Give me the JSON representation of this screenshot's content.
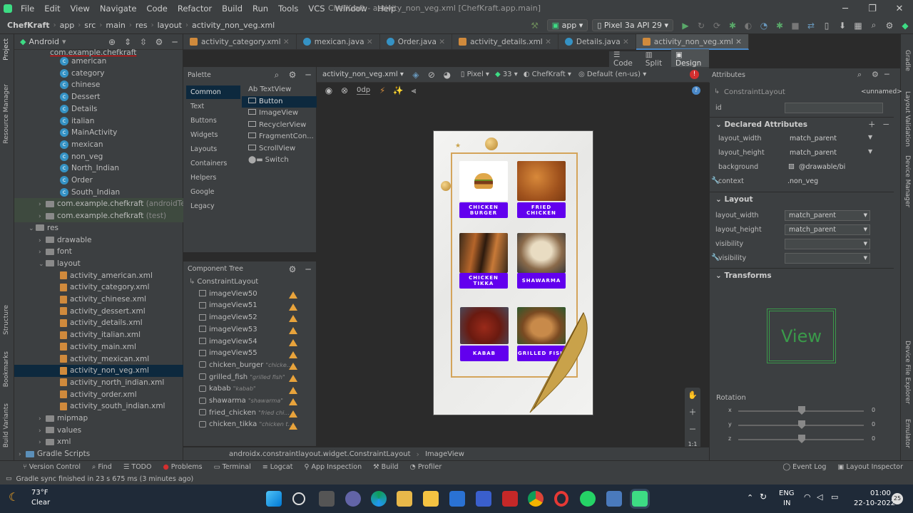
{
  "menu": {
    "items": [
      "File",
      "Edit",
      "View",
      "Navigate",
      "Code",
      "Refactor",
      "Build",
      "Run",
      "Tools",
      "VCS",
      "Window",
      "Help"
    ],
    "title": "ChefKraft - activity_non_veg.xml [ChefKraft.app.main]"
  },
  "nav": {
    "crumbs": [
      "ChefKraft",
      "app",
      "src",
      "main",
      "res",
      "layout",
      "activity_non_veg.xml"
    ],
    "run_config": "app",
    "device": "Pixel 3a API 29"
  },
  "project": {
    "view": "Android",
    "pkg_partial": "com.example.chefkraft",
    "classes": [
      "american",
      "category",
      "chinese",
      "Dessert",
      "Details",
      "italian",
      "MainActivity",
      "mexican",
      "non_veg",
      "North_Indian",
      "Order",
      "South_Indian"
    ],
    "pkg_android_test": "com.example.chefkraft",
    "pkg_android_test_note": "(androidTest)",
    "pkg_test": "com.example.chefkraft",
    "pkg_test_note": "(test)",
    "res": "res",
    "drawable": "drawable",
    "font": "font",
    "layout": "layout",
    "layouts": [
      "activity_american.xml",
      "activity_category.xml",
      "activity_chinese.xml",
      "activity_dessert.xml",
      "activity_details.xml",
      "activity_italian.xml",
      "activity_main.xml",
      "activity_mexican.xml",
      "activity_non_veg.xml",
      "activity_north_indian.xml",
      "activity_order.xml",
      "activity_south_indian.xml"
    ],
    "mipmap": "mipmap",
    "values": "values",
    "xml": "xml",
    "gradle": "Gradle Scripts"
  },
  "left_strip": [
    "Project",
    "Resource Manager",
    "Structure",
    "Bookmarks",
    "Build Variants"
  ],
  "right_strip": [
    "Gradle",
    "Layout Validation",
    "Device Manager",
    "Device File Explorer",
    "Emulator"
  ],
  "tabs": [
    "activity_category.xml",
    "mexican.java",
    "Order.java",
    "activity_details.xml",
    "Details.java",
    "activity_non_veg.xml"
  ],
  "view_modes": [
    "Code",
    "Split",
    "Design"
  ],
  "palette": {
    "title": "Palette",
    "categories": [
      "Common",
      "Text",
      "Buttons",
      "Widgets",
      "Layouts",
      "Containers",
      "Helpers",
      "Google",
      "Legacy"
    ],
    "items": [
      "Ab TextView",
      "Button",
      "ImageView",
      "RecyclerView",
      "FragmentCon...",
      "ScrollView",
      "Switch"
    ]
  },
  "design_toolbar": {
    "file": "activity_non_veg.xml",
    "device": "Pixel",
    "api": "33",
    "theme": "ChefKraft",
    "locale": "Default (en-us)",
    "margin": "0dp"
  },
  "component_tree": {
    "title": "Component Tree",
    "root": "ConstraintLayout",
    "items": [
      {
        "name": "imageView50",
        "hint": ""
      },
      {
        "name": "imageView51",
        "hint": ""
      },
      {
        "name": "imageView52",
        "hint": ""
      },
      {
        "name": "imageView53",
        "hint": ""
      },
      {
        "name": "imageView54",
        "hint": ""
      },
      {
        "name": "imageView55",
        "hint": ""
      },
      {
        "name": "chicken_burger",
        "hint": "\"chicke..."
      },
      {
        "name": "grilled_fish",
        "hint": "\"grilled fish\""
      },
      {
        "name": "kabab",
        "hint": "\"kabab\""
      },
      {
        "name": "shawarma",
        "hint": "\"shawarma\""
      },
      {
        "name": "fried_chicken",
        "hint": "\"fried chi..."
      },
      {
        "name": "chicken_tikka",
        "hint": "\"chicken t..."
      }
    ]
  },
  "phone": {
    "cards": [
      "CHICKEN BURGER",
      "FRIED CHICKEN",
      "CHICKEN TIKKA",
      "SHAWARMA",
      "KABAB",
      "GRILLED FISH"
    ]
  },
  "attributes": {
    "title": "Attributes",
    "component": "ConstraintLayout",
    "unnamed": "<unnamed>",
    "id_label": "id",
    "declared": "Declared Attributes",
    "decl_rows": [
      {
        "k": "layout_width",
        "v": "match_parent"
      },
      {
        "k": "layout_height",
        "v": "match_parent"
      },
      {
        "k": "background",
        "v": "@drawable/bi"
      },
      {
        "k": "context",
        "v": ".non_veg"
      }
    ],
    "layout": "Layout",
    "layout_rows": [
      {
        "k": "layout_width",
        "v": "match_parent"
      },
      {
        "k": "layout_height",
        "v": "match_parent"
      },
      {
        "k": "visibility",
        "v": ""
      },
      {
        "k": "visibility",
        "v": ""
      }
    ],
    "transforms": "Transforms",
    "view_label": "View",
    "rotation": "Rotation",
    "rot": [
      {
        "k": "x",
        "v": "0"
      },
      {
        "k": "y",
        "v": "0"
      },
      {
        "k": "z",
        "v": "0"
      }
    ]
  },
  "path_bar": [
    "androidx.constraintlayout.widget.ConstraintLayout",
    "ImageView"
  ],
  "bottom_tools": [
    "Version Control",
    "Find",
    "TODO",
    "Problems",
    "Terminal",
    "Logcat",
    "App Inspection",
    "Build",
    "Profiler"
  ],
  "bottom_right": [
    "Event Log",
    "Layout Inspector"
  ],
  "status": "Gradle sync finished in 23 s 675 ms (3 minutes ago)",
  "taskbar": {
    "temp": "73°F",
    "weather": "Clear",
    "lang1": "ENG",
    "lang2": "IN",
    "time": "01:00",
    "date": "22-10-2022",
    "badge": "25"
  }
}
